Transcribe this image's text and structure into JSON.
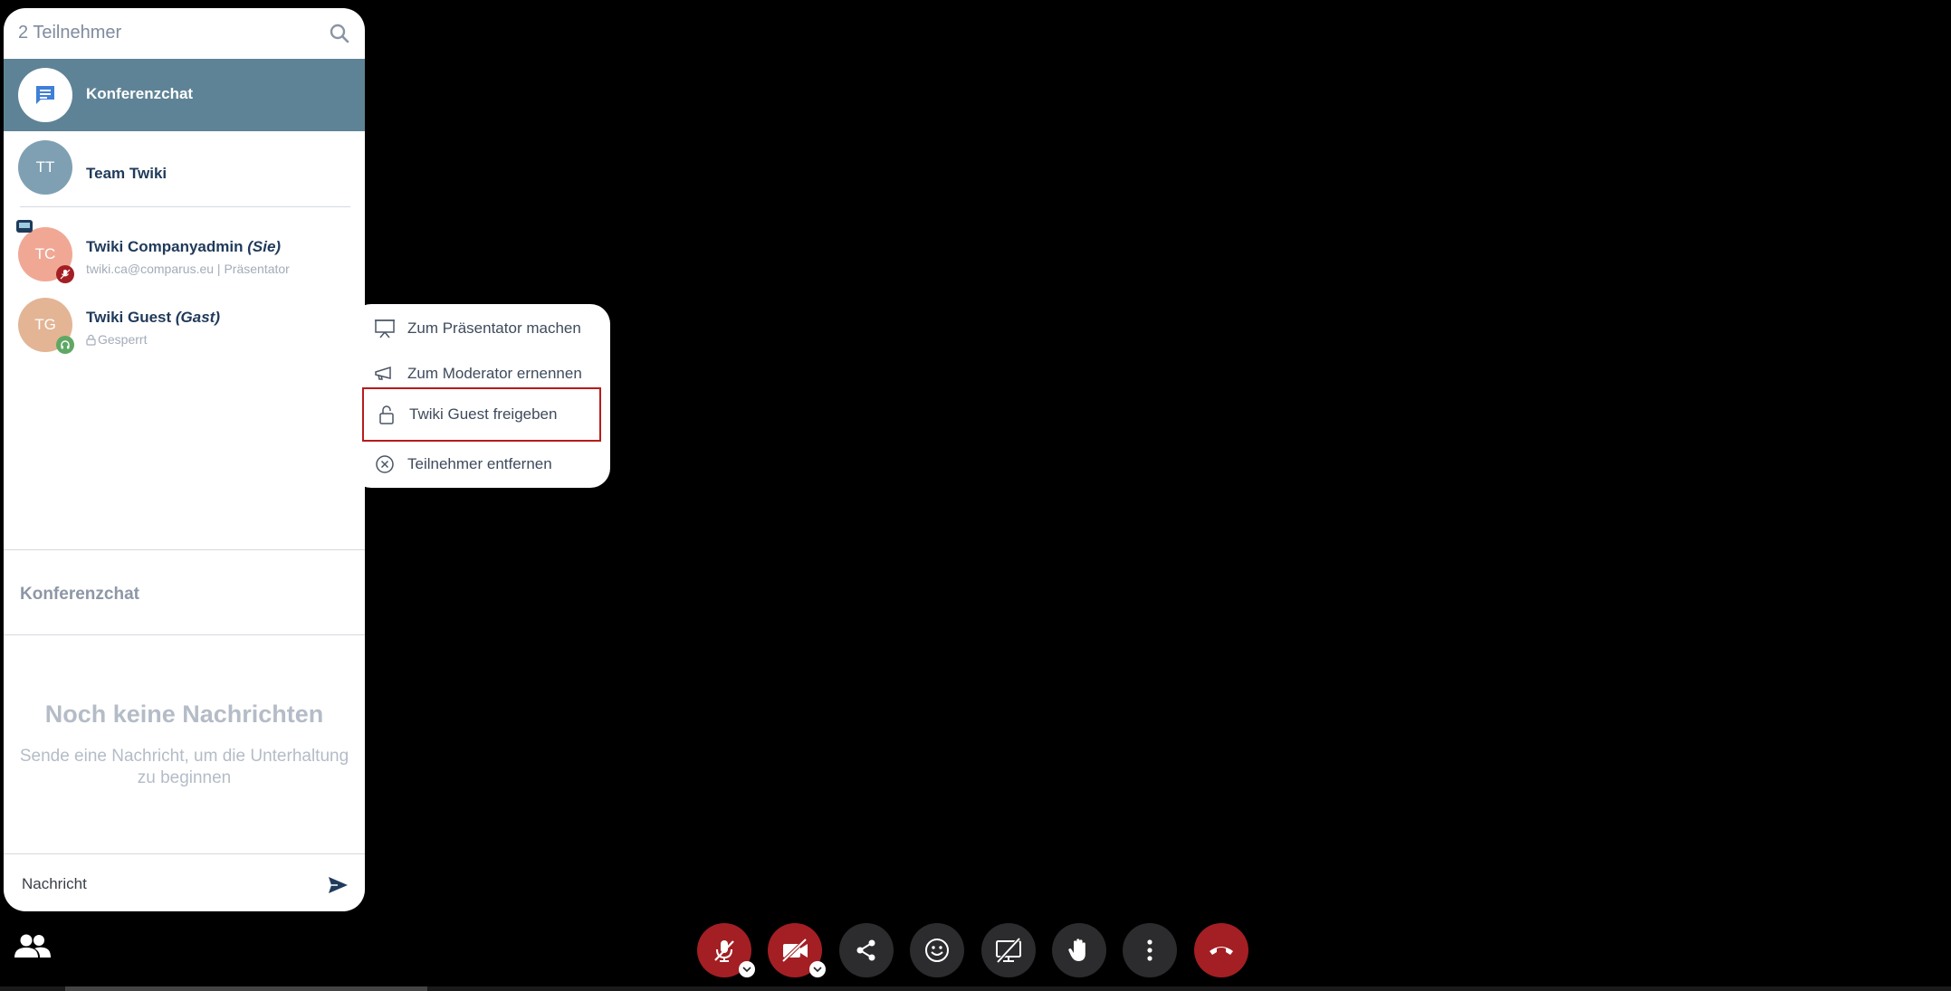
{
  "sidebar": {
    "title": "2 Teilnehmer",
    "conference_chat": {
      "label": "Konferenzchat"
    },
    "team": {
      "initials": "TT",
      "name": "Team Twiki",
      "color": "#7fa0b3"
    },
    "participants": [
      {
        "initials": "TC",
        "name": "Twiki Companyadmin",
        "tag": "(Sie)",
        "sub": "twiki.ca@comparus.eu | Präsentator",
        "color": "#f0a895"
      },
      {
        "initials": "TG",
        "name": "Twiki Guest",
        "tag": "(Gast)",
        "sub": "Gesperrt",
        "color": "#e3b595"
      }
    ]
  },
  "chat": {
    "title": "Konferenzchat",
    "empty_title": "Noch keine Nachrichten",
    "empty_subtitle": "Sende eine Nachricht, um die Unterhaltung zu beginnen",
    "input_placeholder": "Nachricht"
  },
  "context_menu": {
    "items": [
      {
        "label": "Zum Präsentator machen",
        "icon": "presentation-icon"
      },
      {
        "label": "Zum Moderator ernennen",
        "icon": "megaphone-icon"
      },
      {
        "label": "Twiki Guest freigeben",
        "icon": "unlock-icon",
        "selected": true
      },
      {
        "label": "Teilnehmer entfernen",
        "icon": "remove-circle-icon"
      }
    ]
  },
  "toolbar": {
    "buttons": [
      "microphone-muted-icon",
      "camera-off-icon",
      "share-icon",
      "emoji-icon",
      "screen-share-off-icon",
      "raise-hand-icon",
      "more-options-icon",
      "hang-up-icon"
    ]
  },
  "colors": {
    "accent": "#5f8396",
    "danger": "#a31f24",
    "toolbar_gray": "#2c2c2e",
    "text_dark": "#1f3a5a"
  }
}
